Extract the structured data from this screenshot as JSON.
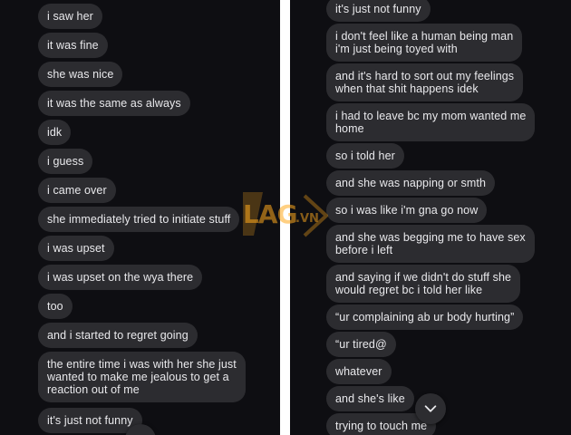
{
  "watermark": {
    "logo": "LAG",
    "suffix": ".VN"
  },
  "left_messages": [
    "i saw her",
    "it was fine",
    "she was nice",
    "it was the same as always",
    "idk",
    "i guess",
    "i came over",
    "she immediately tried to initiate stuff",
    "i was upset",
    "i was upset on the wya there",
    "too",
    "and i started to regret going",
    "the entire time i was with her she just\nwanted to make me jealous to get a\nreaction out of me",
    "it's just not funny"
  ],
  "right_messages": [
    "it's just not funny",
    "i don't feel like a human being man\ni'm just being toyed with",
    "and it's hard to sort out my feelings\nwhen that shit happens idek",
    "i had to leave bc my mom wanted me\nhome",
    "so i told her",
    "and she was napping or smth",
    "so i was like i'm gna go now",
    "and she was begging me to have sex\nbefore i left",
    "and saying if we didn't do stuff she\nwould regret bc i told her like",
    "“ur complaining ab ur body hurting”",
    "“ur tired@",
    "whatever",
    "and she's like",
    "trying to touch me"
  ],
  "icons": {
    "scroll_down": "chevron-down-icon"
  },
  "colors": {
    "background": "#0e0e12",
    "bubble": "#2c2c30",
    "text": "#e9e9ec"
  }
}
